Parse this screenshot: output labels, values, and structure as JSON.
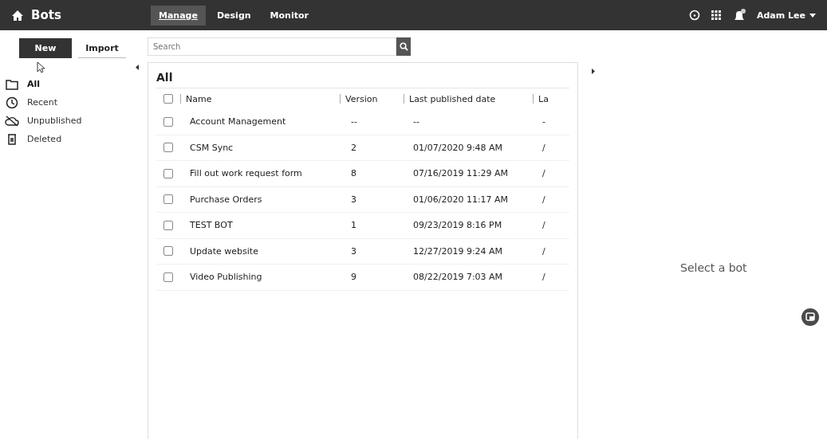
{
  "topbar": {
    "title": "Bots",
    "tabs": [
      {
        "label": "Manage",
        "selected": true
      },
      {
        "label": "Design",
        "selected": false
      },
      {
        "label": "Monitor",
        "selected": false
      }
    ],
    "user": "Adam Lee"
  },
  "actions": {
    "new": "New",
    "import": "Import"
  },
  "search": {
    "placeholder": "Search"
  },
  "sidebar": {
    "items": [
      {
        "label": "All",
        "kind": "folder",
        "selected": true
      },
      {
        "label": "Recent",
        "kind": "clock",
        "selected": false
      },
      {
        "label": "Unpublished",
        "kind": "cloud",
        "selected": false
      },
      {
        "label": "Deleted",
        "kind": "trash",
        "selected": false
      }
    ]
  },
  "list": {
    "title": "All",
    "all_checked": false,
    "columns": [
      "Name",
      "Version",
      "Last published date",
      "La"
    ],
    "rows": [
      {
        "name": "Account Management",
        "version": "--",
        "date": "--",
        "column_4": "-",
        "checked": false
      },
      {
        "name": "CSM Sync",
        "version": "2",
        "date": "01/07/2020 9:48 AM",
        "column_4": "/",
        "checked": false
      },
      {
        "name": "Fill out work request form",
        "version": "8",
        "date": "07/16/2019 11:29 AM",
        "column_4": "/",
        "checked": false
      },
      {
        "name": "Purchase Orders",
        "version": "3",
        "date": "01/06/2020 11:17 AM",
        "column_4": "/",
        "checked": false
      },
      {
        "name": "TEST BOT",
        "version": "1",
        "date": "09/23/2019 8:16 PM",
        "column_4": "/",
        "checked": false
      },
      {
        "name": "Update website",
        "version": "3",
        "date": "12/27/2019 9:24 AM",
        "column_4": "/",
        "checked": false
      },
      {
        "name": "Video Publishing",
        "version": "9",
        "date": "08/22/2019 7:03 AM",
        "column_4": "/",
        "checked": false
      }
    ]
  },
  "detail": {
    "message": "Select a bot"
  }
}
